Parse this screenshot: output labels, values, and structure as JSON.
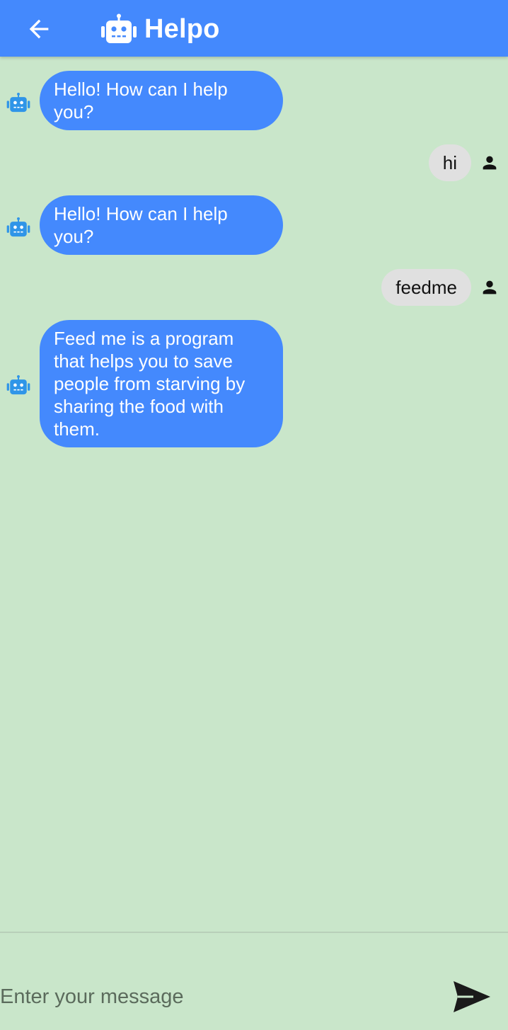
{
  "app_bar": {
    "title": "Helpo",
    "back_icon": "arrow-back-icon",
    "logo_icon": "robot-icon",
    "background_color": "#4489fd"
  },
  "messages": [
    {
      "sender": "bot",
      "text": "Hello! How can I help you?"
    },
    {
      "sender": "user",
      "text": "hi"
    },
    {
      "sender": "bot",
      "text": "Hello! How can I help you?"
    },
    {
      "sender": "user",
      "text": "feedme"
    },
    {
      "sender": "bot",
      "text": "Feed me is a program that helps you to save people from starving by sharing the food with them."
    }
  ],
  "composer": {
    "placeholder": "Enter your message",
    "value": "",
    "send_icon": "send-icon"
  },
  "colors": {
    "background": "#c9e6ca",
    "bot_bubble": "#4489fd",
    "user_bubble": "#e0e0e0",
    "bot_avatar": "#2f95e8"
  }
}
